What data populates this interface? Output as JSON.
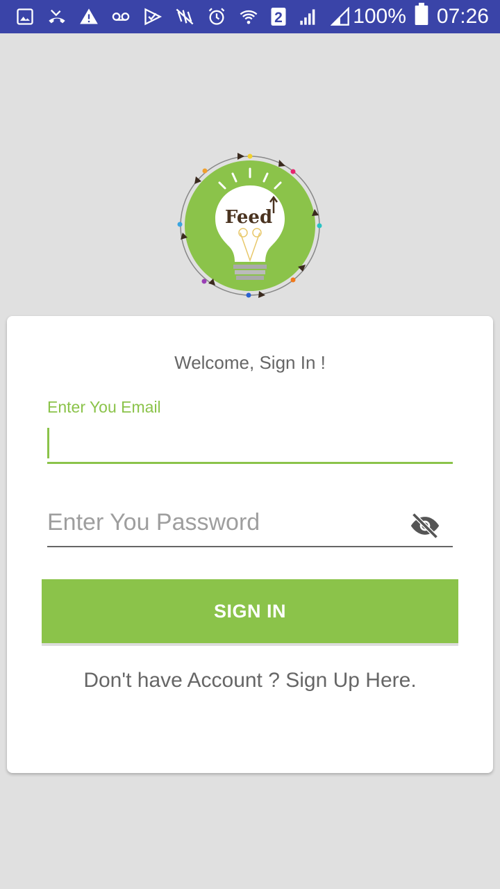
{
  "status_bar": {
    "battery": "100%",
    "sim": "2",
    "time": "07:26",
    "icons": [
      "image-icon",
      "missed-call-icon",
      "warning-icon",
      "voicemail-icon",
      "check-icon",
      "nfc-icon",
      "alarm-icon",
      "wifi-icon",
      "sim-icon",
      "signal-icon",
      "signal-icon-2",
      "battery-icon"
    ]
  },
  "logo": {
    "text": "Feed"
  },
  "login": {
    "welcome": "Welcome, Sign In !",
    "email_label": "Enter You Email",
    "email_value": "",
    "password_placeholder": "Enter You Password",
    "sign_in_label": "SIGN IN",
    "signup_text": "Don't have Account ? Sign Up Here."
  },
  "colors": {
    "accent": "#8bc34a",
    "status_bar": "#3a44a8",
    "background": "#e0e0e0"
  }
}
